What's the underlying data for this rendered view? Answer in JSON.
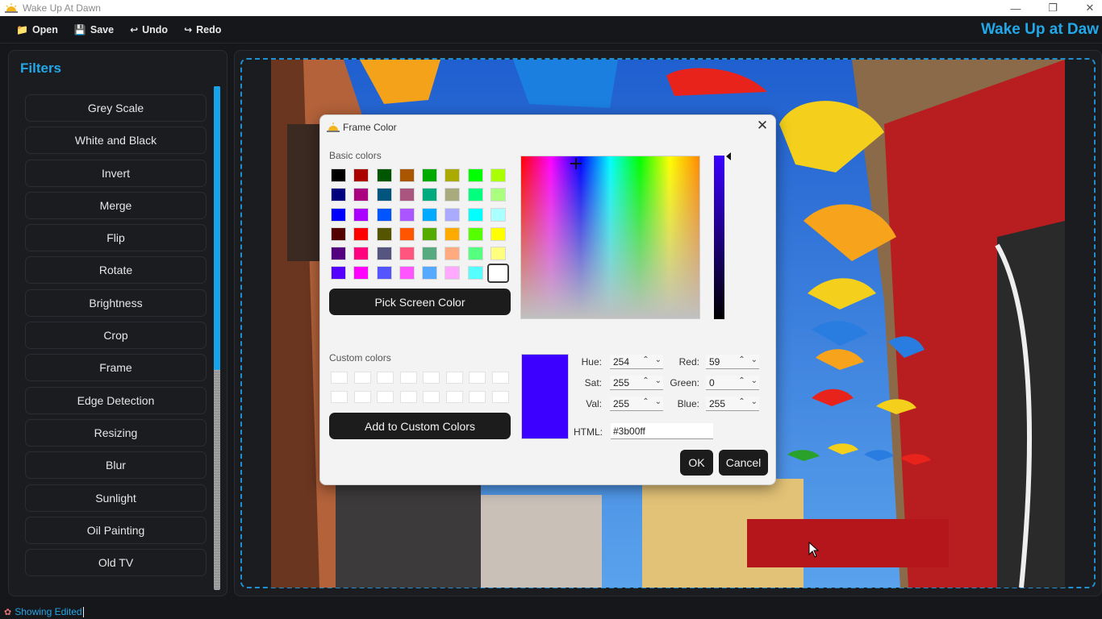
{
  "window": {
    "title": "Wake Up At Dawn",
    "controls": [
      "minimize",
      "maximize",
      "close"
    ]
  },
  "toolbar": {
    "items": [
      {
        "label": "Open",
        "icon": "folder-icon"
      },
      {
        "label": "Save",
        "icon": "floppy-disk-icon"
      },
      {
        "label": "Undo",
        "icon": "undo-arrow-icon"
      },
      {
        "label": "Redo",
        "icon": "redo-arrow-icon"
      }
    ],
    "brand": "Wake Up at Daw"
  },
  "filters": {
    "heading": "Filters",
    "items": [
      "Grey Scale",
      "White and Black",
      "Invert",
      "Merge",
      "Flip",
      "Rotate",
      "Brightness",
      "Crop",
      "Frame",
      "Edge Detection",
      "Resizing",
      "Blur",
      "Sunlight",
      "Oil Painting",
      "Old TV"
    ]
  },
  "status": {
    "text": "Showing Edited"
  },
  "dialog": {
    "title": "Frame Color",
    "basic_colors_label": "Basic colors",
    "basic_colors": [
      "#000000",
      "#aa0000",
      "#005500",
      "#aa5500",
      "#00aa00",
      "#aaaa00",
      "#00ff00",
      "#aaff00",
      "#00007f",
      "#aa007f",
      "#00557f",
      "#aa557f",
      "#00aa7f",
      "#aaaa7f",
      "#00ff7f",
      "#aaff7f",
      "#0000ff",
      "#aa00ff",
      "#0055ff",
      "#aa55ff",
      "#00aaff",
      "#aaaaff",
      "#00ffff",
      "#aaffff",
      "#550000",
      "#ff0000",
      "#555500",
      "#ff5500",
      "#55aa00",
      "#ffaa00",
      "#55ff00",
      "#ffff00",
      "#55007f",
      "#ff007f",
      "#55557f",
      "#ff557f",
      "#55aa7f",
      "#ffaa7f",
      "#55ff7f",
      "#ffff7f",
      "#5500ff",
      "#ff00ff",
      "#5555ff",
      "#ff55ff",
      "#55aaff",
      "#ffaaff",
      "#55ffff",
      "#ffffff"
    ],
    "pick_screen_label": "Pick Screen Color",
    "custom_colors_label": "Custom colors",
    "add_custom_label": "Add to Custom Colors",
    "current_color": "#3b00ff",
    "hue_label": "Hue:",
    "hue": "254",
    "sat_label": "Sat:",
    "sat": "255",
    "val_label": "Val:",
    "val": "255",
    "red_label": "Red:",
    "red": "59",
    "green_label": "Green:",
    "green": "0",
    "blue_label": "Blue:",
    "blue": "255",
    "html_label": "HTML:",
    "html": "#3b00ff",
    "ok_label": "OK",
    "cancel_label": "Cancel"
  },
  "accent_color": "#22a7e8"
}
